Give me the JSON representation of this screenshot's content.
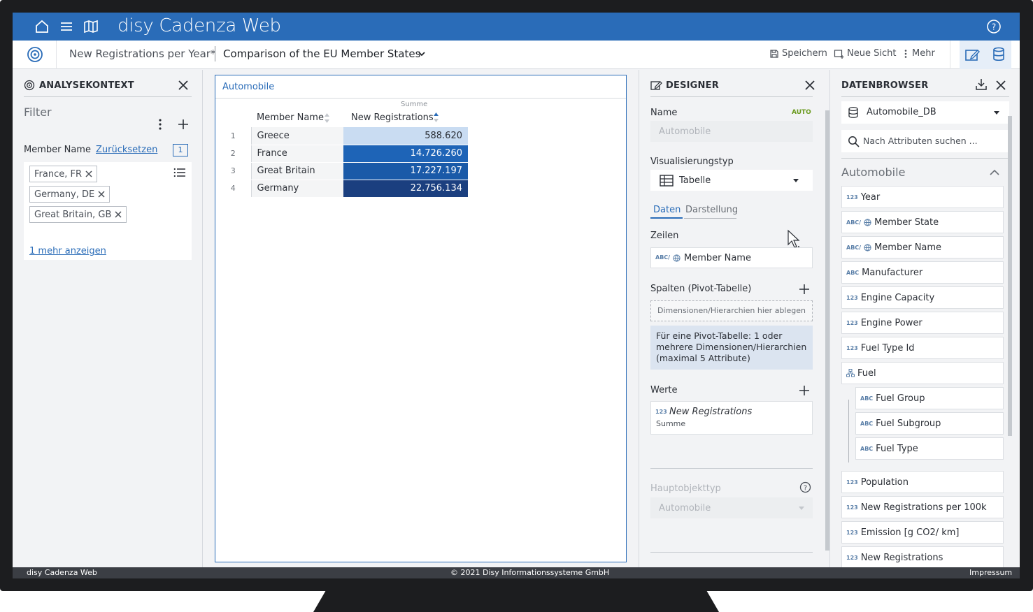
{
  "app": {
    "title": "disy Cadenza Web"
  },
  "subbar": {
    "breadcrumb_view": "New Registrations per Year*",
    "breadcrumb_sheet": "Comparison of the EU Member States",
    "save_label": "Speichern",
    "new_view_label": "Neue Sicht",
    "more_label": "Mehr"
  },
  "analysis": {
    "title": "ANALYSEKONTEXT",
    "filter_placeholder": "Filter",
    "member_label": "Member Name",
    "reset_label": "Zurücksetzen",
    "count": "1",
    "chips": [
      "France, FR",
      "Germany, DE",
      "Great Britain, GB"
    ],
    "show_more": "1 mehr anzeigen"
  },
  "table": {
    "title": "Automobile",
    "agg_label": "Summe",
    "col_name": "Member Name",
    "col_value": "New Registrations",
    "rows": [
      {
        "n": "1",
        "name": "Greece",
        "value": "588.620",
        "color": "#c9dcf2"
      },
      {
        "n": "2",
        "name": "France",
        "value": "14.726.260",
        "color": "#1e64b7"
      },
      {
        "n": "3",
        "name": "Great Britain",
        "value": "17.227.197",
        "color": "#1a5aa8"
      },
      {
        "n": "4",
        "name": "Germany",
        "value": "22.756.134",
        "color": "#1b3f7f"
      }
    ]
  },
  "designer": {
    "title": "DESIGNER",
    "name_label": "Name",
    "auto_badge": "AUTO",
    "name_placeholder": "Automobile",
    "vis_label": "Visualisierungstyp",
    "vis_value": "Tabelle",
    "tab_data": "Daten",
    "tab_display": "Darstellung",
    "rows_label": "Zeilen",
    "rows_item": "Member Name",
    "rows_item_badge": "ABC/",
    "cols_label": "Spalten (Pivot-Tabelle)",
    "cols_drop": "Dimensionen/Hierarchien hier ablegen",
    "cols_hint": "Für eine Pivot-Tabelle: 1 oder mehrere Dimensionen/Hierarchien (maximal 5 Attribute)",
    "values_label": "Werte",
    "values_item": "New Registrations",
    "values_badge": "123",
    "values_sub": "Summe",
    "main_type_label": "Hauptobjekttyp",
    "main_type_value": "Automobile"
  },
  "browser": {
    "title": "DATENBROWSER",
    "db_value": "Automobile_DB",
    "search_placeholder": "Nach Attributen suchen ...",
    "group": "Automobile",
    "attrs": [
      {
        "badge": "123",
        "label": "Year"
      },
      {
        "badge": "ABC/",
        "label": "Member State",
        "globe": true
      },
      {
        "badge": "ABC/",
        "label": "Member Name",
        "globe": true
      },
      {
        "badge": "ABC",
        "label": "Manufacturer"
      },
      {
        "badge": "123",
        "label": "Engine Capacity"
      },
      {
        "badge": "123",
        "label": "Engine Power"
      },
      {
        "badge": "123",
        "label": "Fuel Type Id"
      },
      {
        "badge": "hier",
        "label": "Fuel"
      },
      {
        "badge": "ABC",
        "label": "Fuel Group",
        "child": true
      },
      {
        "badge": "ABC",
        "label": "Fuel Subgroup",
        "child": true
      },
      {
        "badge": "ABC",
        "label": "Fuel Type",
        "child": true
      },
      {
        "badge": "123",
        "label": "Population"
      },
      {
        "badge": "123",
        "label": "New Registrations per 100k"
      },
      {
        "badge": "123",
        "label": "Emission [g CO2/ km]"
      },
      {
        "badge": "123",
        "label": "New Registrations"
      }
    ]
  },
  "footer": {
    "left": "disy Cadenza Web",
    "center": "© 2021 Disy Informationssysteme GmbH",
    "right": "Impressum"
  }
}
